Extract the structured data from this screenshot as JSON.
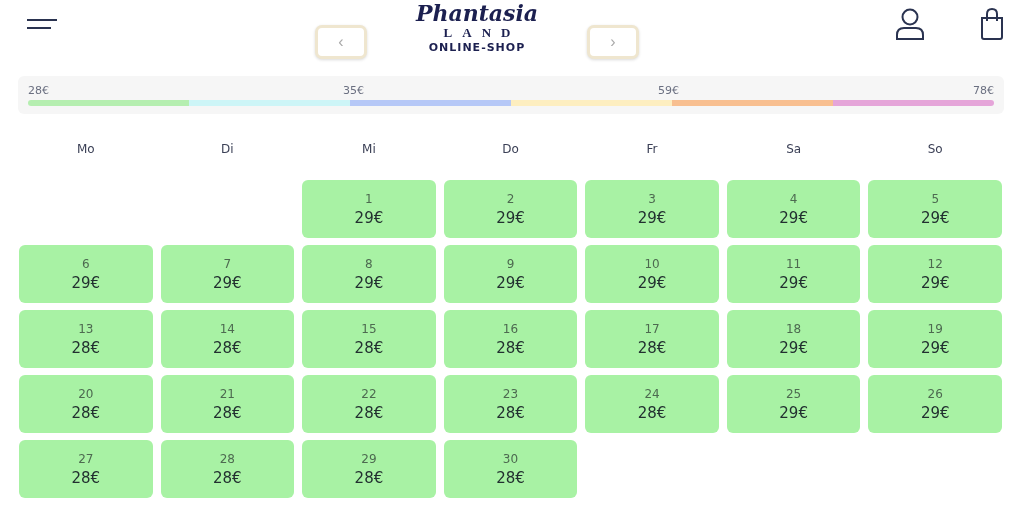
{
  "logo": {
    "name": "Phantasia",
    "sub": "LAND",
    "tagline": "ONLINE-SHOP"
  },
  "nav": {
    "prev": "‹",
    "next": "›"
  },
  "price_scale": {
    "ticks": [
      "28€",
      "35€",
      "59€",
      "78€"
    ],
    "segments": [
      {
        "color": "#b5eeb0"
      },
      {
        "color": "#cdf5f7"
      },
      {
        "color": "#b6c8f7"
      },
      {
        "color": "#fdeec0"
      },
      {
        "color": "#f8bf90"
      },
      {
        "color": "#e5a5d9"
      }
    ]
  },
  "weekdays": [
    "Mo",
    "Di",
    "Mi",
    "Do",
    "Fr",
    "Sa",
    "So"
  ],
  "weeks": [
    {
      "right_aligned": true,
      "days": [
        {
          "day": "1",
          "price": "29€",
          "color": "#a8f2a4"
        },
        {
          "day": "2",
          "price": "29€",
          "color": "#a8f2a4"
        },
        {
          "day": "3",
          "price": "29€",
          "color": "#a8f2a4"
        },
        {
          "day": "4",
          "price": "29€",
          "color": "#a8f2a4"
        },
        {
          "day": "5",
          "price": "29€",
          "color": "#a8f2a4"
        }
      ]
    },
    {
      "days": [
        {
          "day": "6",
          "price": "29€",
          "color": "#a8f2a4"
        },
        {
          "day": "7",
          "price": "29€",
          "color": "#a8f2a4"
        },
        {
          "day": "8",
          "price": "29€",
          "color": "#a8f2a4"
        },
        {
          "day": "9",
          "price": "29€",
          "color": "#a8f2a4"
        },
        {
          "day": "10",
          "price": "29€",
          "color": "#a8f2a4"
        },
        {
          "day": "11",
          "price": "29€",
          "color": "#a8f2a4"
        },
        {
          "day": "12",
          "price": "29€",
          "color": "#a8f2a4"
        }
      ]
    },
    {
      "days": [
        {
          "day": "13",
          "price": "28€",
          "color": "#a8f2a4"
        },
        {
          "day": "14",
          "price": "28€",
          "color": "#a8f2a4"
        },
        {
          "day": "15",
          "price": "28€",
          "color": "#a8f2a4"
        },
        {
          "day": "16",
          "price": "28€",
          "color": "#a8f2a4"
        },
        {
          "day": "17",
          "price": "28€",
          "color": "#a8f2a4"
        },
        {
          "day": "18",
          "price": "29€",
          "color": "#a8f2a4"
        },
        {
          "day": "19",
          "price": "29€",
          "color": "#a8f2a4"
        }
      ]
    },
    {
      "days": [
        {
          "day": "20",
          "price": "28€",
          "color": "#a8f2a4"
        },
        {
          "day": "21",
          "price": "28€",
          "color": "#a8f2a4"
        },
        {
          "day": "22",
          "price": "28€",
          "color": "#a8f2a4"
        },
        {
          "day": "23",
          "price": "28€",
          "color": "#a8f2a4"
        },
        {
          "day": "24",
          "price": "28€",
          "color": "#a8f2a4"
        },
        {
          "day": "25",
          "price": "29€",
          "color": "#a8f2a4"
        },
        {
          "day": "26",
          "price": "29€",
          "color": "#a8f2a4"
        }
      ]
    },
    {
      "right_aligned": false,
      "days": [
        {
          "day": "27",
          "price": "28€",
          "color": "#a8f2a4"
        },
        {
          "day": "28",
          "price": "28€",
          "color": "#a8f2a4"
        },
        {
          "day": "29",
          "price": "28€",
          "color": "#a8f2a4"
        },
        {
          "day": "30",
          "price": "28€",
          "color": "#a8f2a4"
        }
      ]
    }
  ]
}
